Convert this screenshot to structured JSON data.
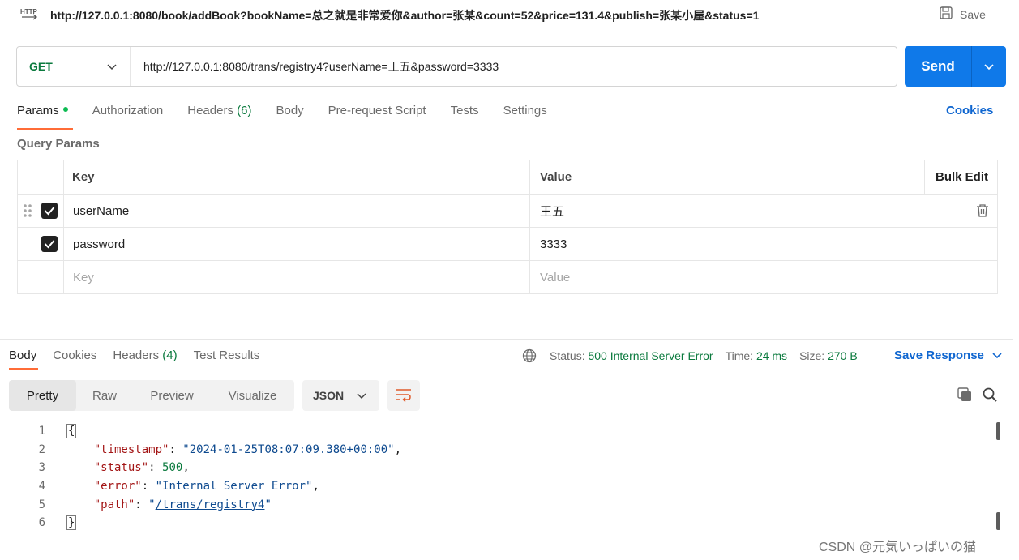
{
  "header": {
    "title": "http://127.0.0.1:8080/book/addBook?bookName=总之就是非常爱你&author=张某&count=52&price=131.4&publish=张某小屋&status=1",
    "save_label": "Save"
  },
  "request": {
    "method": "GET",
    "url": "http://127.0.0.1:8080/trans/registry4?userName=王五&password=3333",
    "send_label": "Send"
  },
  "request_tabs": {
    "params": "Params",
    "authorization": "Authorization",
    "headers": "Headers",
    "headers_count": "(6)",
    "body": "Body",
    "prerequest": "Pre-request Script",
    "tests": "Tests",
    "settings": "Settings",
    "cookies": "Cookies"
  },
  "query_params": {
    "title": "Query Params",
    "col_key": "Key",
    "col_value": "Value",
    "bulk_edit": "Bulk Edit",
    "rows": [
      {
        "key": "userName",
        "value": "王五",
        "checked": true
      },
      {
        "key": "password",
        "value": "3333",
        "checked": true
      }
    ],
    "key_placeholder": "Key",
    "value_placeholder": "Value"
  },
  "response_tabs": {
    "body": "Body",
    "cookies": "Cookies",
    "headers": "Headers",
    "headers_count": "(4)",
    "test_results": "Test Results"
  },
  "response_meta": {
    "status_label": "Status:",
    "status_value": "500 Internal Server Error",
    "time_label": "Time:",
    "time_value": "24 ms",
    "size_label": "Size:",
    "size_value": "270 B",
    "save_response": "Save Response"
  },
  "views": {
    "pretty": "Pretty",
    "raw": "Raw",
    "preview": "Preview",
    "visualize": "Visualize",
    "format": "JSON"
  },
  "response_body": {
    "line_numbers": [
      "1",
      "2",
      "3",
      "4",
      "5",
      "6"
    ],
    "open_brace": "{",
    "close_brace": "}",
    "timestamp_key": "\"timestamp\"",
    "timestamp_value": "\"2024-01-25T08:07:09.380+00:00\"",
    "status_key": "\"status\"",
    "status_value": "500",
    "error_key": "\"error\"",
    "error_value": "\"Internal Server Error\"",
    "path_key": "\"path\"",
    "path_value": "/trans/registry4"
  },
  "watermark": "CSDN @元気いっぱいの猫",
  "colors": {
    "send": "#0f79e9",
    "active_tab": "#ff6c37",
    "method_get": "#0b7a3e",
    "link": "#0f66d0"
  }
}
